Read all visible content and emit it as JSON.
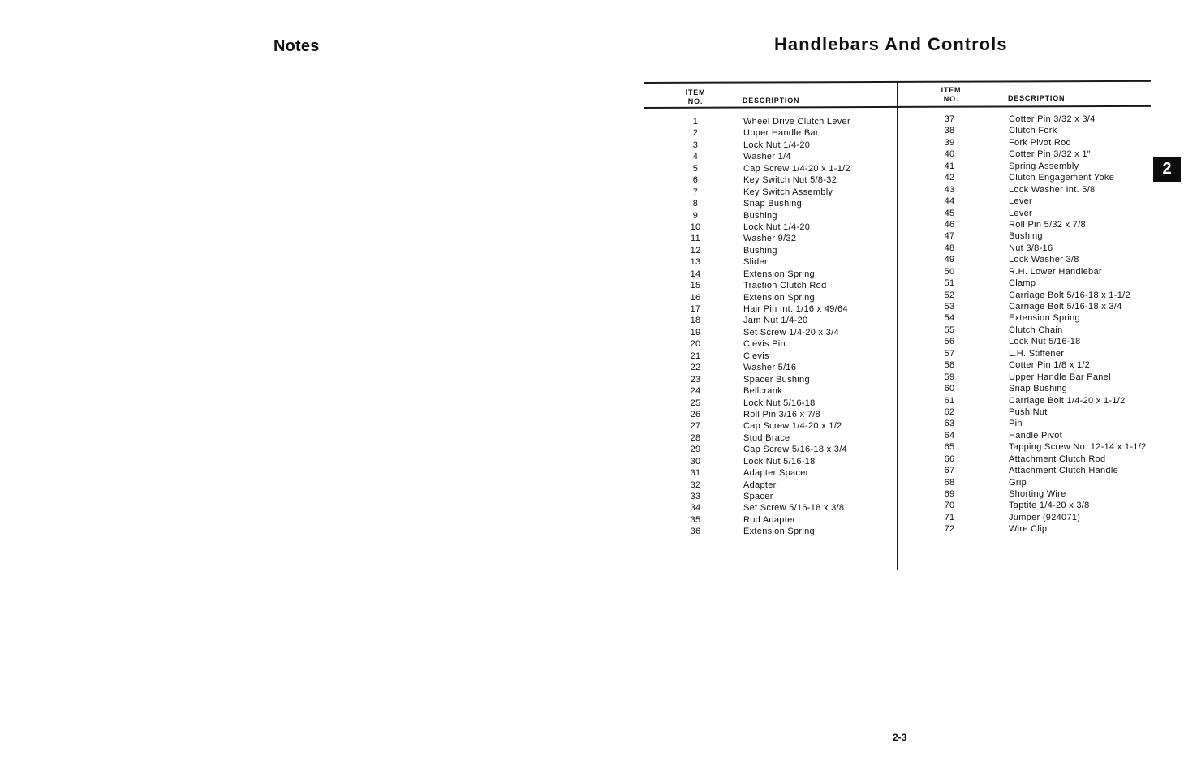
{
  "left_page": {
    "title": "Notes"
  },
  "right_page": {
    "title": "Handlebars And Controls",
    "section_tab": "2",
    "page_number": "2-3"
  },
  "parts_table": {
    "headers": {
      "item_no_line1": "ITEM",
      "item_no_line2": "NO.",
      "description": "DESCRIPTION"
    },
    "left_column": [
      {
        "no": "1",
        "description": "Wheel Drive Clutch Lever"
      },
      {
        "no": "2",
        "description": "Upper Handle Bar"
      },
      {
        "no": "3",
        "description": "Lock Nut 1/4-20"
      },
      {
        "no": "4",
        "description": "Washer 1/4"
      },
      {
        "no": "5",
        "description": "Cap Screw 1/4-20 x 1-1/2"
      },
      {
        "no": "6",
        "description": "Key Switch Nut 5/8-32"
      },
      {
        "no": "7",
        "description": "Key Switch Assembly"
      },
      {
        "no": "8",
        "description": "Snap Bushing"
      },
      {
        "no": "9",
        "description": "Bushing"
      },
      {
        "no": "10",
        "description": "Lock Nut 1/4-20"
      },
      {
        "no": "11",
        "description": "Washer 9/32"
      },
      {
        "no": "12",
        "description": "Bushing"
      },
      {
        "no": "13",
        "description": "Slider"
      },
      {
        "no": "14",
        "description": "Extension Spring"
      },
      {
        "no": "15",
        "description": "Traction Clutch Rod"
      },
      {
        "no": "16",
        "description": "Extension Spring"
      },
      {
        "no": "17",
        "description": "Hair Pin Int. 1/16 x 49/64"
      },
      {
        "no": "18",
        "description": "Jam Nut 1/4-20"
      },
      {
        "no": "19",
        "description": "Set Screw 1/4-20 x 3/4"
      },
      {
        "no": "20",
        "description": "Clevis Pin"
      },
      {
        "no": "21",
        "description": "Clevis"
      },
      {
        "no": "22",
        "description": "Washer 5/16"
      },
      {
        "no": "23",
        "description": "Spacer Bushing"
      },
      {
        "no": "24",
        "description": "Bellcrank"
      },
      {
        "no": "25",
        "description": "Lock Nut 5/16-18"
      },
      {
        "no": "26",
        "description": "Roll Pin 3/16 x 7/8"
      },
      {
        "no": "27",
        "description": "Cap Screw 1/4-20 x 1/2"
      },
      {
        "no": "28",
        "description": "Stud Brace"
      },
      {
        "no": "29",
        "description": "Cap Screw 5/16-18 x 3/4"
      },
      {
        "no": "30",
        "description": "Lock Nut 5/16-18"
      },
      {
        "no": "31",
        "description": "Adapter Spacer"
      },
      {
        "no": "32",
        "description": "Adapter"
      },
      {
        "no": "33",
        "description": "Spacer"
      },
      {
        "no": "34",
        "description": "Set Screw 5/16-18 x 3/8"
      },
      {
        "no": "35",
        "description": "Rod Adapter"
      },
      {
        "no": "36",
        "description": "Extension Spring"
      }
    ],
    "right_column": [
      {
        "no": "37",
        "description": "Cotter Pin 3/32 x 3/4"
      },
      {
        "no": "38",
        "description": "Clutch Fork"
      },
      {
        "no": "39",
        "description": "Fork Pivot Rod"
      },
      {
        "no": "40",
        "description": "Cotter Pin 3/32 x 1\""
      },
      {
        "no": "41",
        "description": "Spring Assembly"
      },
      {
        "no": "42",
        "description": "Clutch Engagement Yoke"
      },
      {
        "no": "43",
        "description": "Lock Washer Int. 5/8"
      },
      {
        "no": "44",
        "description": "Lever"
      },
      {
        "no": "45",
        "description": "Lever"
      },
      {
        "no": "46",
        "description": "Roll Pin 5/32 x 7/8"
      },
      {
        "no": "47",
        "description": "Bushing"
      },
      {
        "no": "48",
        "description": "Nut 3/8-16"
      },
      {
        "no": "49",
        "description": "Lock Washer 3/8"
      },
      {
        "no": "50",
        "description": "R.H. Lower Handlebar"
      },
      {
        "no": "51",
        "description": "Clamp"
      },
      {
        "no": "52",
        "description": "Carriage Bolt 5/16-18 x 1-1/2"
      },
      {
        "no": "53",
        "description": "Carriage Bolt 5/16-18 x 3/4"
      },
      {
        "no": "54",
        "description": "Extension Spring"
      },
      {
        "no": "55",
        "description": "Clutch Chain"
      },
      {
        "no": "56",
        "description": "Lock Nut 5/16-18"
      },
      {
        "no": "57",
        "description": "L.H. Stiffener"
      },
      {
        "no": "58",
        "description": "Cotter Pin 1/8 x 1/2"
      },
      {
        "no": "59",
        "description": "Upper Handle Bar Panel"
      },
      {
        "no": "60",
        "description": "Snap Bushing"
      },
      {
        "no": "61",
        "description": "Carriage Bolt 1/4-20 x 1-1/2"
      },
      {
        "no": "62",
        "description": "Push Nut"
      },
      {
        "no": "63",
        "description": "Pin"
      },
      {
        "no": "64",
        "description": "Handle Pivot"
      },
      {
        "no": "65",
        "description": "Tapping Screw No. 12-14 x 1-1/2"
      },
      {
        "no": "66",
        "description": "Attachment Clutch Rod"
      },
      {
        "no": "67",
        "description": "Attachment Clutch Handle"
      },
      {
        "no": "68",
        "description": "Grip"
      },
      {
        "no": "69",
        "description": "Shorting Wire"
      },
      {
        "no": "70",
        "description": "Taptite 1/4-20 x 3/8"
      },
      {
        "no": "71",
        "description": "Jumper (924071)"
      },
      {
        "no": "72",
        "description": "Wire Clip"
      }
    ]
  }
}
